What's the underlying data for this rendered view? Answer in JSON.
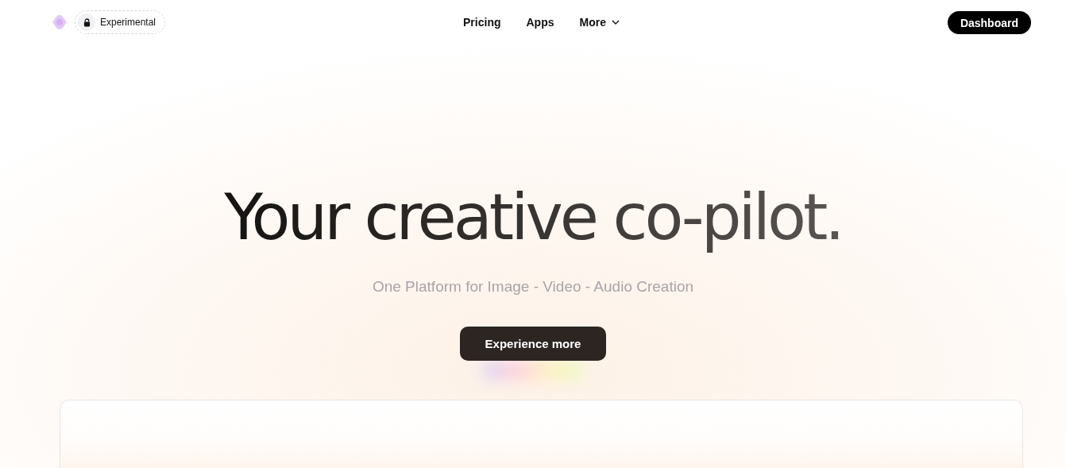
{
  "nav": {
    "badge": "Experimental",
    "links": [
      {
        "label": "Pricing",
        "kind": "link"
      },
      {
        "label": "Apps",
        "kind": "link"
      },
      {
        "label": "More",
        "kind": "menu"
      }
    ],
    "action": "Dashboard"
  },
  "hero": {
    "title": "Your creative co-pilot.",
    "subtitle": "One Platform for Image - Video - Audio Creation",
    "button": "Experience more"
  }
}
